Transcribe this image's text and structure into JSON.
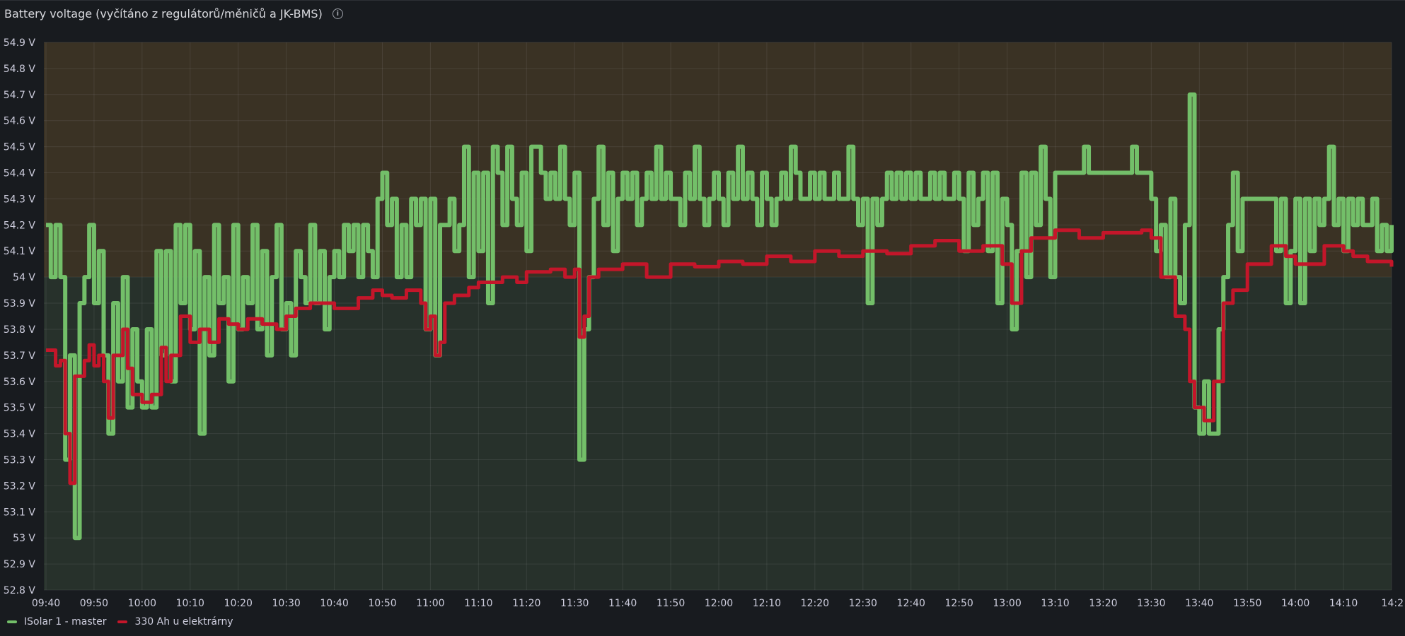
{
  "panel": {
    "title": "Battery voltage (vyčítáno z regulátorů/měničů a JK-BMS)",
    "info_icon": "info-circle-icon"
  },
  "colors": {
    "green": "#73bf69",
    "red": "#c4162a",
    "band_high": "#3a3224",
    "band_low": "#27312b"
  },
  "chart_data": {
    "type": "line",
    "title": "Battery voltage (vyčítáno z regulátorů/měničů a JK-BMS)",
    "xlabel": "",
    "ylabel": "",
    "ylim": [
      52.8,
      54.9
    ],
    "y_unit": "V",
    "threshold": 54.0,
    "y_ticks": [
      "54.9 V",
      "54.8 V",
      "54.7 V",
      "54.6 V",
      "54.5 V",
      "54.4 V",
      "54.3 V",
      "54.2 V",
      "54.1 V",
      "54 V",
      "53.9 V",
      "53.8 V",
      "53.7 V",
      "53.6 V",
      "53.5 V",
      "53.4 V",
      "53.3 V",
      "53.2 V",
      "53.1 V",
      "53 V",
      "52.9 V",
      "52.8 V"
    ],
    "x_ticks": [
      "09:40",
      "09:50",
      "10:00",
      "10:10",
      "10:20",
      "10:30",
      "10:40",
      "10:50",
      "11:00",
      "11:10",
      "11:20",
      "11:30",
      "11:40",
      "11:50",
      "12:00",
      "12:10",
      "12:20",
      "12:30",
      "12:40",
      "12:50",
      "13:00",
      "13:10",
      "13:20",
      "13:30",
      "13:40",
      "13:50",
      "14:00",
      "14:10",
      "14:2"
    ],
    "x_start": "09:40",
    "x_step_minutes": 1,
    "legend_position": "bottom-left",
    "grid": true,
    "series": [
      {
        "name": "ISolar 1 - master",
        "color": "#73bf69",
        "interpolation": "step",
        "values": [
          54.2,
          54.0,
          54.2,
          54.0,
          53.3,
          53.7,
          53.0,
          53.9,
          54.0,
          54.2,
          53.9,
          54.1,
          53.7,
          53.4,
          53.9,
          53.6,
          54.0,
          53.5,
          53.8,
          53.6,
          53.5,
          53.8,
          53.5,
          54.1,
          53.7,
          54.1,
          53.6,
          54.2,
          53.9,
          54.2,
          53.8,
          54.1,
          53.4,
          54.0,
          53.7,
          54.2,
          53.9,
          54.0,
          53.6,
          54.2,
          53.8,
          54.0,
          53.9,
          54.2,
          53.8,
          54.1,
          53.7,
          54.0,
          54.2,
          53.8,
          53.9,
          53.7,
          54.1,
          54.0,
          53.9,
          54.2,
          53.9,
          54.1,
          53.8,
          54.0,
          54.1,
          54.0,
          54.2,
          54.1,
          54.2,
          54.0,
          54.2,
          54.1,
          54.0,
          54.3,
          54.4,
          54.2,
          54.3,
          54.0,
          54.2,
          54.0,
          54.3,
          54.2,
          54.3,
          53.8,
          54.3,
          53.7,
          54.2,
          54.2,
          54.3,
          54.1,
          54.2,
          54.5,
          54.0,
          54.4,
          54.1,
          54.4,
          53.9,
          54.5,
          54.4,
          54.2,
          54.5,
          54.3,
          54.2,
          54.4,
          54.1,
          54.5,
          54.5,
          54.4,
          54.3,
          54.4,
          54.3,
          54.5,
          54.3,
          54.2,
          54.4,
          53.3,
          53.8,
          54.0,
          54.3,
          54.5,
          54.2,
          54.4,
          54.1,
          54.3,
          54.4,
          54.3,
          54.4,
          54.2,
          54.3,
          54.4,
          54.3,
          54.5,
          54.3,
          54.4,
          54.3,
          54.3,
          54.2,
          54.4,
          54.3,
          54.5,
          54.3,
          54.2,
          54.3,
          54.4,
          54.3,
          54.2,
          54.4,
          54.3,
          54.5,
          54.3,
          54.4,
          54.3,
          54.2,
          54.4,
          54.3,
          54.2,
          54.3,
          54.4,
          54.3,
          54.5,
          54.4,
          54.3,
          54.3,
          54.4,
          54.3,
          54.4,
          54.3,
          54.3,
          54.4,
          54.3,
          54.3,
          54.5,
          54.3,
          54.2,
          54.3,
          53.9,
          54.3,
          54.2,
          54.3,
          54.4,
          54.3,
          54.4,
          54.3,
          54.4,
          54.3,
          54.4,
          54.3,
          54.3,
          54.4,
          54.3,
          54.4,
          54.3,
          54.3,
          54.4,
          54.3,
          54.1,
          54.4,
          54.2,
          54.3,
          54.4,
          54.1,
          54.4,
          53.9,
          54.3,
          54.2,
          53.8,
          54.1,
          54.4,
          54.0,
          54.4,
          54.2,
          54.5,
          54.3,
          54.0,
          54.4,
          54.4,
          54.4,
          54.4,
          54.4,
          54.4,
          54.5,
          54.4,
          54.4,
          54.4,
          54.4,
          54.4,
          54.4,
          54.4,
          54.4,
          54.4,
          54.5,
          54.4,
          54.4,
          54.4,
          54.3,
          54.1,
          54.2,
          54.0,
          54.3,
          54.0,
          53.9,
          54.2,
          54.7,
          53.5,
          53.4,
          53.6,
          53.4,
          53.4,
          53.8,
          54.0,
          54.2,
          54.4,
          54.1,
          54.3,
          54.3,
          54.3,
          54.3,
          54.3,
          54.3,
          54.3,
          54.1,
          54.3,
          53.9,
          54.1,
          54.3,
          53.9,
          54.3,
          54.1,
          54.3,
          54.2,
          54.3,
          54.5,
          54.2,
          54.3,
          54.1,
          54.3,
          54.2,
          54.3,
          54.2,
          54.2,
          54.3,
          54.1,
          54.2,
          54.1,
          54.2
        ]
      },
      {
        "name": "330 Ah u elektrárny",
        "color": "#c4162a",
        "interpolation": "step",
        "points": [
          [
            0,
            53.72
          ],
          [
            2,
            53.66
          ],
          [
            3,
            53.68
          ],
          [
            4,
            53.4
          ],
          [
            5,
            53.21
          ],
          [
            6,
            53.62
          ],
          [
            8,
            53.68
          ],
          [
            9,
            53.74
          ],
          [
            10,
            53.66
          ],
          [
            11,
            53.7
          ],
          [
            12,
            53.6
          ],
          [
            13,
            53.46
          ],
          [
            14,
            53.7
          ],
          [
            16,
            53.8
          ],
          [
            17,
            53.65
          ],
          [
            18,
            53.55
          ],
          [
            20,
            53.52
          ],
          [
            22,
            53.55
          ],
          [
            24,
            53.73
          ],
          [
            25,
            53.6
          ],
          [
            26,
            53.7
          ],
          [
            28,
            53.85
          ],
          [
            30,
            53.75
          ],
          [
            32,
            53.8
          ],
          [
            34,
            53.75
          ],
          [
            36,
            53.84
          ],
          [
            38,
            53.82
          ],
          [
            40,
            53.8
          ],
          [
            42,
            53.84
          ],
          [
            45,
            53.82
          ],
          [
            48,
            53.8
          ],
          [
            50,
            53.85
          ],
          [
            52,
            53.88
          ],
          [
            55,
            53.9
          ],
          [
            60,
            53.88
          ],
          [
            65,
            53.92
          ],
          [
            68,
            53.95
          ],
          [
            70,
            53.93
          ],
          [
            72,
            53.92
          ],
          [
            75,
            53.95
          ],
          [
            78,
            53.9
          ],
          [
            79,
            53.8
          ],
          [
            80,
            53.85
          ],
          [
            81,
            53.7
          ],
          [
            82,
            53.75
          ],
          [
            83,
            53.9
          ],
          [
            85,
            53.93
          ],
          [
            88,
            53.96
          ],
          [
            90,
            53.98
          ],
          [
            95,
            54.0
          ],
          [
            98,
            53.98
          ],
          [
            100,
            54.02
          ],
          [
            105,
            54.03
          ],
          [
            108,
            54.0
          ],
          [
            110,
            54.03
          ],
          [
            111,
            53.77
          ],
          [
            112,
            53.85
          ],
          [
            113,
            54.0
          ],
          [
            115,
            54.03
          ],
          [
            120,
            54.05
          ],
          [
            125,
            54.0
          ],
          [
            130,
            54.05
          ],
          [
            135,
            54.04
          ],
          [
            140,
            54.06
          ],
          [
            145,
            54.05
          ],
          [
            150,
            54.08
          ],
          [
            155,
            54.06
          ],
          [
            160,
            54.1
          ],
          [
            165,
            54.08
          ],
          [
            170,
            54.1
          ],
          [
            175,
            54.09
          ],
          [
            180,
            54.12
          ],
          [
            185,
            54.14
          ],
          [
            190,
            54.1
          ],
          [
            195,
            54.12
          ],
          [
            199,
            54.05
          ],
          [
            201,
            53.9
          ],
          [
            203,
            54.1
          ],
          [
            205,
            54.15
          ],
          [
            210,
            54.18
          ],
          [
            215,
            54.15
          ],
          [
            220,
            54.17
          ],
          [
            228,
            54.18
          ],
          [
            230,
            54.15
          ],
          [
            232,
            54.0
          ],
          [
            235,
            53.85
          ],
          [
            237,
            53.8
          ],
          [
            238,
            53.6
          ],
          [
            239,
            53.5
          ],
          [
            241,
            53.45
          ],
          [
            243,
            53.6
          ],
          [
            245,
            53.9
          ],
          [
            247,
            53.95
          ],
          [
            250,
            54.05
          ],
          [
            255,
            54.12
          ],
          [
            258,
            54.08
          ],
          [
            260,
            54.05
          ],
          [
            263,
            54.05
          ],
          [
            266,
            54.12
          ],
          [
            270,
            54.1
          ],
          [
            272,
            54.08
          ],
          [
            275,
            54.06
          ],
          [
            280,
            54.04
          ]
        ]
      }
    ]
  },
  "legend": [
    {
      "label": "ISolar 1 - master"
    },
    {
      "label": "330 Ah u elektrárny"
    }
  ]
}
